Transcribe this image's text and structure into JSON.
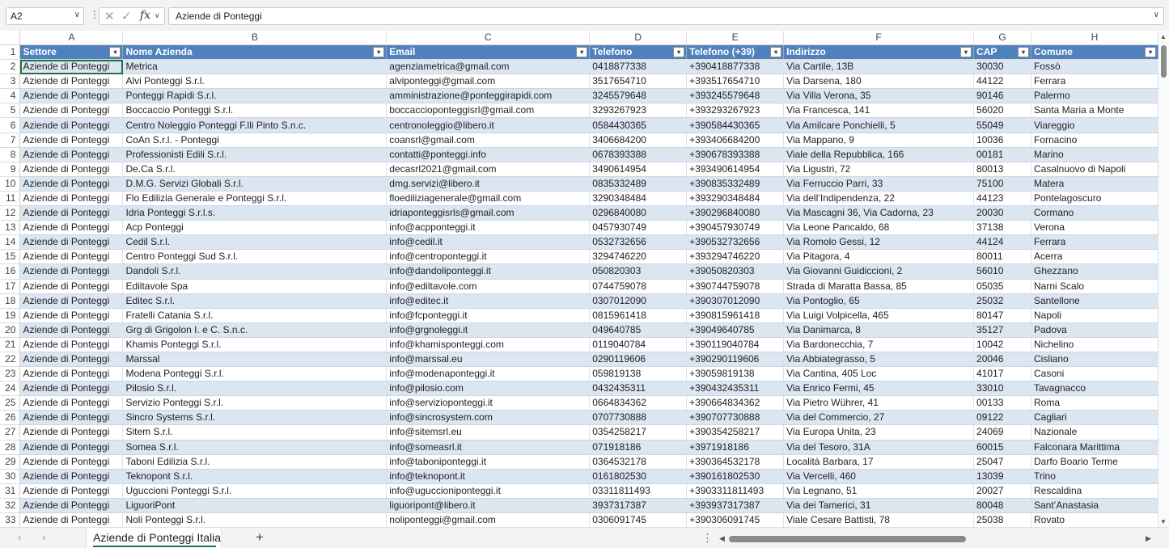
{
  "name_box": {
    "value": "A2"
  },
  "formula_bar": {
    "value": "Aziende di Ponteggi"
  },
  "columns": [
    "A",
    "B",
    "C",
    "D",
    "E",
    "F",
    "G",
    "H"
  ],
  "header_row_number": "1",
  "headers": [
    "Settore",
    "Nome Azienda",
    "Email",
    "Telefono",
    "Telefono (+39)",
    "Indirizzo",
    "CAP",
    "Comune"
  ],
  "rows": [
    {
      "n": "2",
      "cells": [
        "Aziende di Ponteggi",
        "Metrica",
        "agenziametrica@gmail.com",
        "0418877338",
        "+390418877338",
        "Via Cartile, 13B",
        "30030",
        "Fossò"
      ]
    },
    {
      "n": "3",
      "cells": [
        "Aziende di Ponteggi",
        "Alvi Ponteggi S.r.l.",
        "alviponteggi@gmail.com",
        "3517654710",
        "+393517654710",
        "Via Darsena, 180",
        "44122",
        "Ferrara"
      ]
    },
    {
      "n": "4",
      "cells": [
        "Aziende di Ponteggi",
        "Ponteggi Rapidi S.r.l.",
        "amministrazione@ponteggirapidi.com",
        "3245579648",
        "+393245579648",
        "Via Villa Verona, 35",
        "90146",
        "Palermo"
      ]
    },
    {
      "n": "5",
      "cells": [
        "Aziende di Ponteggi",
        "Boccaccio Ponteggi S.r.l.",
        "boccaccioponteggisrl@gmail.com",
        "3293267923",
        "+393293267923",
        "Via Francesca, 141",
        "56020",
        "Santa Maria a Monte"
      ]
    },
    {
      "n": "6",
      "cells": [
        "Aziende di Ponteggi",
        "Centro Noleggio Ponteggi F.lli Pinto S.n.c.",
        "centronoleggio@libero.it",
        "0584430365",
        "+390584430365",
        "Via Amilcare Ponchielli, 5",
        "55049",
        "Viareggio"
      ]
    },
    {
      "n": "7",
      "cells": [
        "Aziende di Ponteggi",
        "CoAn S.r.l. - Ponteggi",
        "coansrl@gmail.com",
        "3406684200",
        "+393406684200",
        "Via Mappano, 9",
        "10036",
        "Fornacino"
      ]
    },
    {
      "n": "8",
      "cells": [
        "Aziende di Ponteggi",
        "Professionisti Edili S.r.l.",
        "contatti@ponteggi.info",
        "0678393388",
        "+390678393388",
        "Viale della Repubblica, 166",
        "00181",
        "Marino"
      ]
    },
    {
      "n": "9",
      "cells": [
        "Aziende di Ponteggi",
        "De.Ca S.r.l.",
        "decasrl2021@gmail.com",
        "3490614954",
        "+393490614954",
        "Via Ligustri, 72",
        "80013",
        "Casalnuovo di Napoli"
      ]
    },
    {
      "n": "10",
      "cells": [
        "Aziende di Ponteggi",
        "D.M.G. Servizi Globali S.r.l.",
        "dmg.servizi@libero.it",
        "0835332489",
        "+390835332489",
        "Via Ferruccio Parri, 33",
        "75100",
        "Matera"
      ]
    },
    {
      "n": "11",
      "cells": [
        "Aziende di Ponteggi",
        "Flo Edilizia Generale e Ponteggi S.r.l.",
        "floediliziagenerale@gmail.com",
        "3290348484",
        "+393290348484",
        "Via dell’Indipendenza, 22",
        "44123",
        "Pontelagoscuro"
      ]
    },
    {
      "n": "12",
      "cells": [
        "Aziende di Ponteggi",
        "Idria Ponteggi S.r.l.s.",
        "idriaponteggisrls@gmail.com",
        "0296840080",
        "+390296840080",
        "Via Mascagni 36, Via Cadorna, 23",
        "20030",
        "Cormano"
      ]
    },
    {
      "n": "13",
      "cells": [
        "Aziende di Ponteggi",
        "Acp Ponteggi",
        "info@acpponteggi.it",
        "0457930749",
        "+390457930749",
        "Via Leone Pancaldo, 68",
        "37138",
        "Verona"
      ]
    },
    {
      "n": "14",
      "cells": [
        "Aziende di Ponteggi",
        "Cedil S.r.l.",
        "info@cedil.it",
        "0532732656",
        "+390532732656",
        "Via Romolo Gessi, 12",
        "44124",
        "Ferrara"
      ]
    },
    {
      "n": "15",
      "cells": [
        "Aziende di Ponteggi",
        "Centro Ponteggi Sud S.r.l.",
        "info@centroponteggi.it",
        "3294746220",
        "+393294746220",
        "Via Pitagora, 4",
        "80011",
        "Acerra"
      ]
    },
    {
      "n": "16",
      "cells": [
        "Aziende di Ponteggi",
        "Dandoli S.r.l.",
        "info@dandoliponteggi.it",
        "050820303",
        "+39050820303",
        "Via Giovanni Guidiccioni, 2",
        "56010",
        "Ghezzano"
      ]
    },
    {
      "n": "17",
      "cells": [
        "Aziende di Ponteggi",
        "Ediltavole Spa",
        "info@ediltavole.com",
        "0744759078",
        "+390744759078",
        "Strada di Maratta Bassa, 85",
        "05035",
        "Narni Scalo"
      ]
    },
    {
      "n": "18",
      "cells": [
        "Aziende di Ponteggi",
        "Editec S.r.l.",
        "info@editec.it",
        "0307012090",
        "+390307012090",
        "Via Pontoglio, 65",
        "25032",
        "Santellone"
      ]
    },
    {
      "n": "19",
      "cells": [
        "Aziende di Ponteggi",
        "Fratelli Catania S.r.l.",
        "info@fcponteggi.it",
        "0815961418",
        "+390815961418",
        "Via Luigi Volpicella, 465",
        "80147",
        "Napoli"
      ]
    },
    {
      "n": "20",
      "cells": [
        "Aziende di Ponteggi",
        "Grg di Grigolon I. e C. S.n.c.",
        "info@grgnoleggi.it",
        "049640785",
        "+39049640785",
        "Via Danimarca, 8",
        "35127",
        "Padova"
      ]
    },
    {
      "n": "21",
      "cells": [
        "Aziende di Ponteggi",
        "Khamis Ponteggi S.r.l.",
        "info@khamisponteggi.com",
        "0119040784",
        "+390119040784",
        "Via Bardonecchia, 7",
        "10042",
        "Nichelino"
      ]
    },
    {
      "n": "22",
      "cells": [
        "Aziende di Ponteggi",
        "Marssal",
        "info@marssal.eu",
        "0290119606",
        "+390290119606",
        "Via Abbiategrasso, 5",
        "20046",
        "Cisliano"
      ]
    },
    {
      "n": "23",
      "cells": [
        "Aziende di Ponteggi",
        "Modena Ponteggi S.r.l.",
        "info@modenaponteggi.it",
        "059819138",
        "+39059819138",
        "Via Cantina, 405 Loc",
        "41017",
        "Casoni"
      ]
    },
    {
      "n": "24",
      "cells": [
        "Aziende di Ponteggi",
        "Pilosio S.r.l.",
        "info@pilosio.com",
        "0432435311",
        "+390432435311",
        "Via Enrico Fermi, 45",
        "33010",
        "Tavagnacco"
      ]
    },
    {
      "n": "25",
      "cells": [
        "Aziende di Ponteggi",
        "Servizio Ponteggi S.r.l.",
        "info@servizioponteggi.it",
        "0664834362",
        "+390664834362",
        "Via Pietro Wührer, 41",
        "00133",
        "Roma"
      ]
    },
    {
      "n": "26",
      "cells": [
        "Aziende di Ponteggi",
        "Sincro Systems S.r.l.",
        "info@sincrosystem.com",
        "0707730888",
        "+390707730888",
        "Via del Commercio, 27",
        "09122",
        "Cagliari"
      ]
    },
    {
      "n": "27",
      "cells": [
        "Aziende di Ponteggi",
        "Sitem S.r.l.",
        "info@sitemsrl.eu",
        "0354258217",
        "+390354258217",
        "Via Europa Unita, 23",
        "24069",
        "Nazionale"
      ]
    },
    {
      "n": "28",
      "cells": [
        "Aziende di Ponteggi",
        "Somea S.r.l.",
        "info@someasrl.it",
        "071918186",
        "+3971918186",
        "Via del Tesoro, 31A",
        "60015",
        "Falconara Marittima"
      ]
    },
    {
      "n": "29",
      "cells": [
        "Aziende di Ponteggi",
        "Taboni Edilizia S.r.l.",
        "info@taboniponteggi.it",
        "0364532178",
        "+390364532178",
        "Località Barbara, 17",
        "25047",
        "Darfo Boario Terme"
      ]
    },
    {
      "n": "30",
      "cells": [
        "Aziende di Ponteggi",
        "Teknopont S.r.l.",
        "info@teknopont.it",
        "0161802530",
        "+390161802530",
        "Via Vercelli, 460",
        "13039",
        "Trino"
      ]
    },
    {
      "n": "31",
      "cells": [
        "Aziende di Ponteggi",
        "Uguccioni Ponteggi S.r.l.",
        "info@uguccioniponteggi.it",
        "03311811493",
        "+3903311811493",
        "Via Legnano, 51",
        "20027",
        "Rescaldina"
      ]
    },
    {
      "n": "32",
      "cells": [
        "Aziende di Ponteggi",
        "LiguoriPont",
        "liguoripont@libero.it",
        "3937317387",
        "+393937317387",
        "Via dei Tamerici, 31",
        "80048",
        "Sant’Anastasia"
      ]
    },
    {
      "n": "33",
      "cells": [
        "Aziende di Ponteggi",
        "Noli Ponteggi S.r.l.",
        "noliponteggi@gmail.com",
        "0306091745",
        "+390306091745",
        "Viale Cesare Battisti, 78",
        "25038",
        "Rovato"
      ]
    }
  ],
  "sheet_tab": {
    "label": "Aziende di Ponteggi Italia"
  },
  "icons": {
    "cancel": "close-icon",
    "confirm": "check-icon",
    "function": "fx-icon",
    "filter": "filter-dropdown-icon",
    "add_sheet": "plus-icon"
  },
  "colors": {
    "header_fill": "#4f81bd",
    "band_fill": "#dce6f1",
    "selection": "#217346"
  }
}
